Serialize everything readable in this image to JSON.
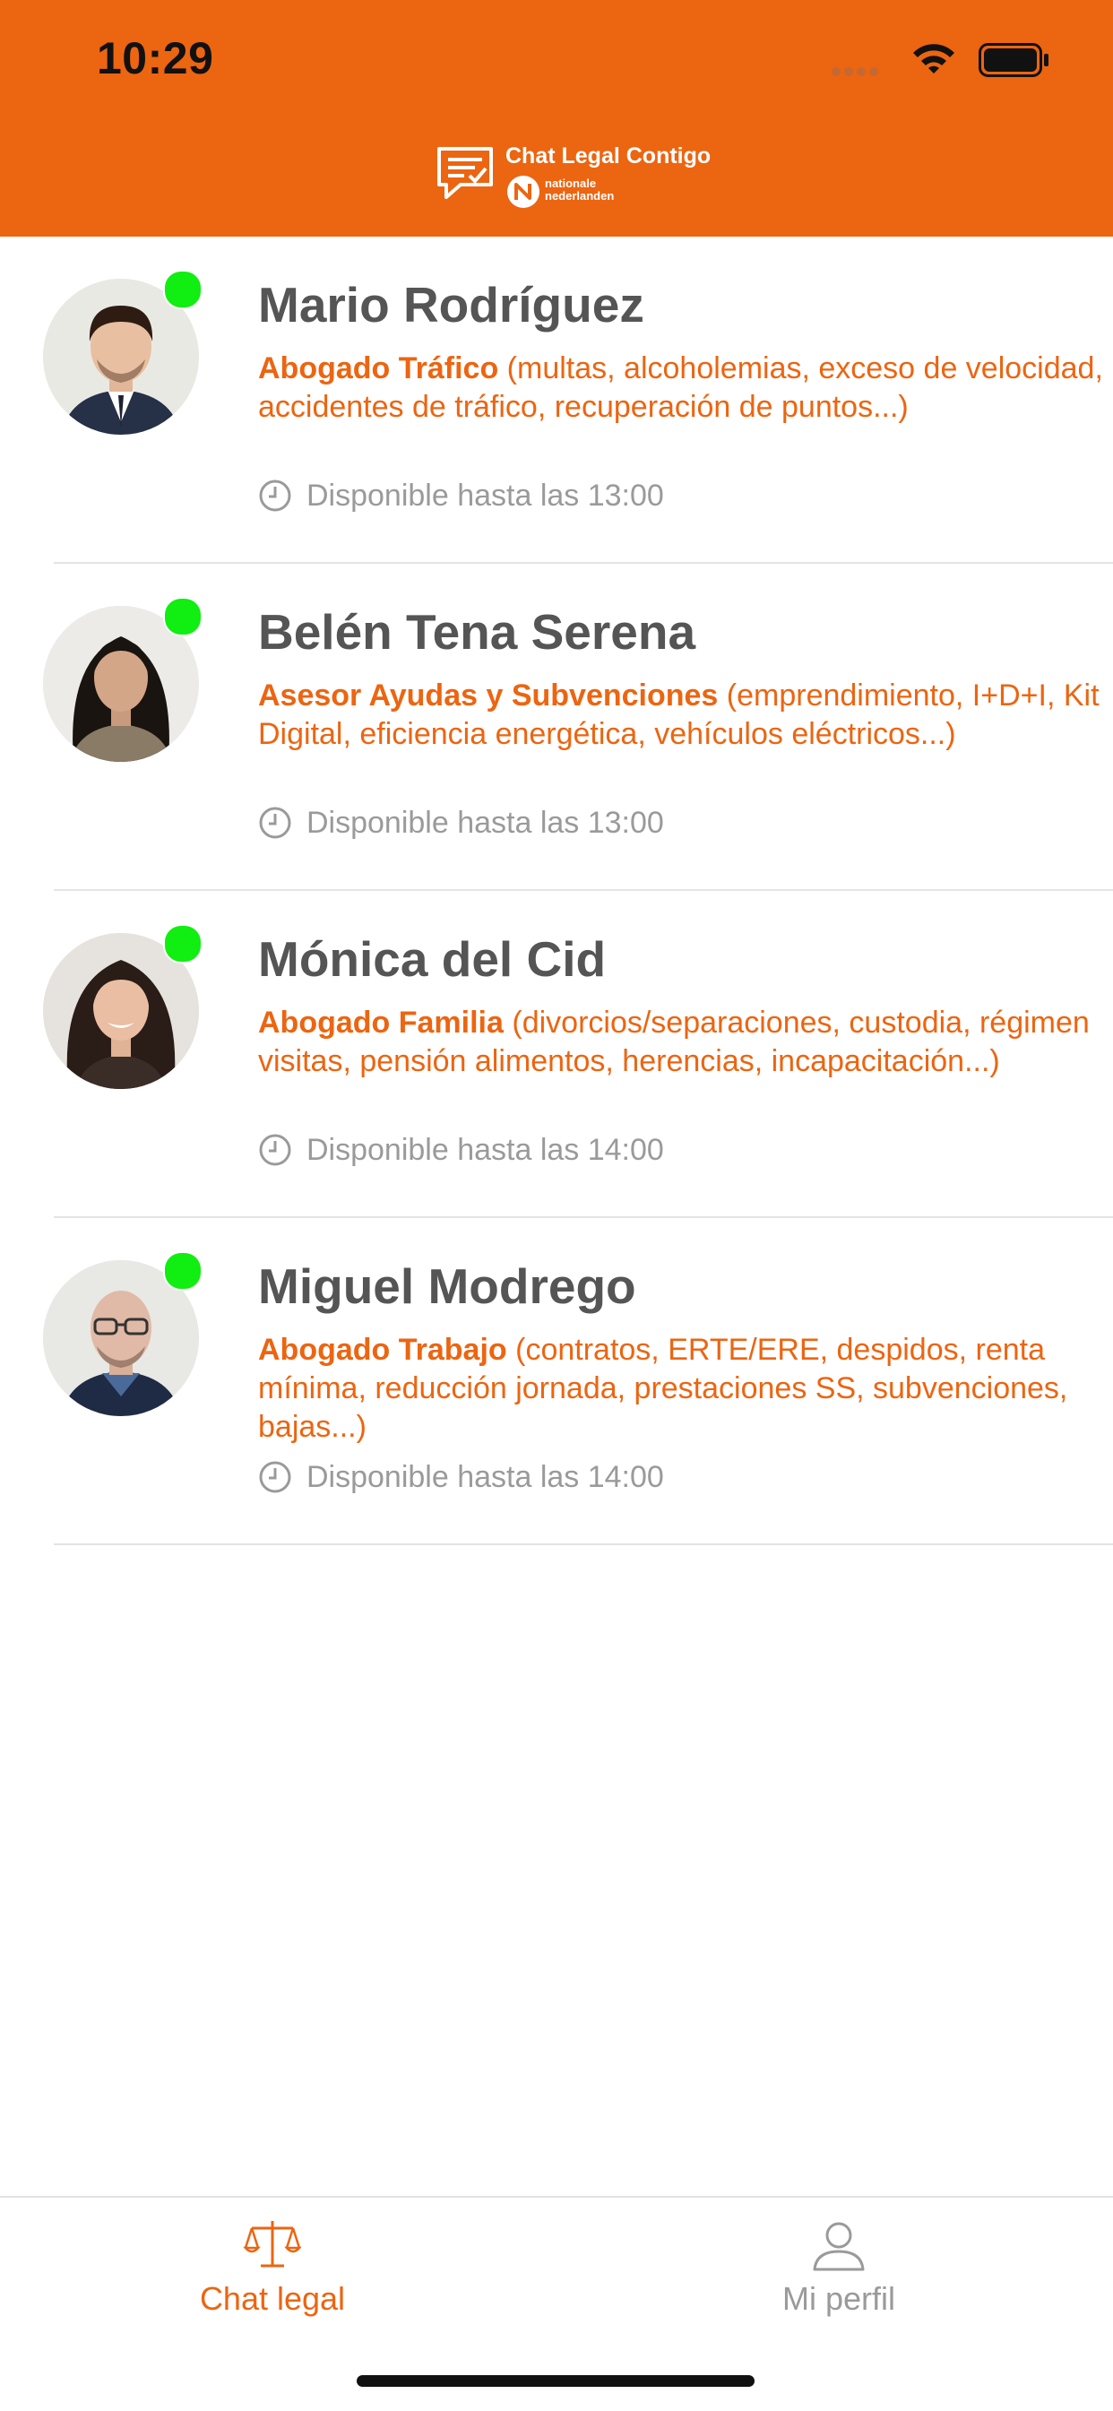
{
  "status_bar": {
    "time": "10:29"
  },
  "header": {
    "logo_title": "Chat Legal Contigo",
    "logo_sub_line1": "nationale",
    "logo_sub_line2": "nederlanden"
  },
  "lawyers": [
    {
      "name": "Mario Rodríguez",
      "specialty": "Abogado Tráfico",
      "details": " (multas, alcoholemias, exceso de velocidad, accidentes de tráfico, recuperación de puntos...)",
      "availability": "Disponible hasta las 13:00",
      "online": true
    },
    {
      "name": "Belén Tena Serena",
      "specialty": "Asesor Ayudas y Subvenciones",
      "details": " (emprendimiento, I+D+I, Kit Digital, eficiencia energética, vehículos eléctricos...)",
      "availability": "Disponible hasta las 13:00",
      "online": true
    },
    {
      "name": "Mónica del Cid",
      "specialty": "Abogado Familia",
      "details": " (divorcios/separaciones, custodia, régimen visitas, pensión alimentos, herencias, incapacitación...)",
      "availability": "Disponible hasta las 14:00",
      "online": true
    },
    {
      "name": "Miguel Modrego",
      "specialty": "Abogado Trabajo",
      "details": " (contratos, ERTE/ERE, despidos, renta mínima, reducción jornada, prestaciones SS, subvenciones, bajas...)",
      "availability": "Disponible hasta las 14:00",
      "online": true
    }
  ],
  "tabbar": {
    "chat_label": "Chat legal",
    "profile_label": "Mi perfil",
    "active": "chat"
  },
  "colors": {
    "brand_orange": "#EC6511",
    "name_gray": "#555555",
    "muted_gray": "#9a9a9a",
    "online_green": "#11ee11"
  },
  "icons": {
    "chat_logo": "chat-document-check-icon",
    "chat_tab": "scales-of-justice-icon",
    "profile_tab": "person-icon",
    "availability": "clock-icon"
  }
}
